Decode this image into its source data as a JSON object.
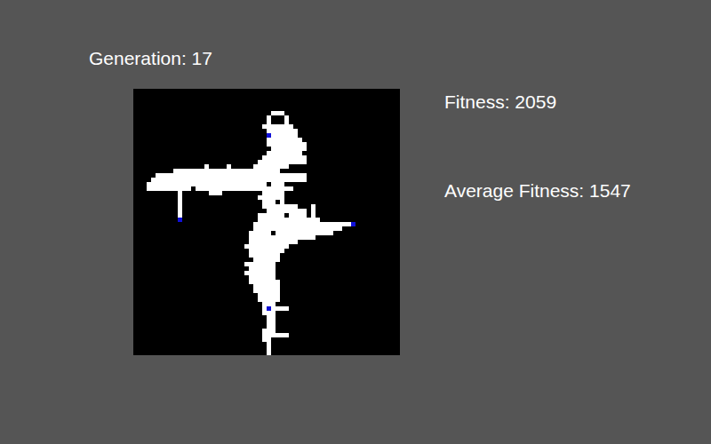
{
  "generation_label": "Generation: 17",
  "fitness_label": "Fitness: 2059",
  "average_fitness_label": "Average Fitness: 1547",
  "grid": {
    "cells": [
      [
        5,
        31,
        33
      ],
      [
        6,
        30,
        30
      ],
      [
        6,
        34,
        34
      ],
      [
        7,
        30,
        30
      ],
      [
        7,
        34,
        34
      ],
      [
        8,
        29,
        35
      ],
      [
        9,
        30,
        36
      ],
      [
        10,
        30,
        36
      ],
      [
        11,
        30,
        37
      ],
      [
        12,
        30,
        38
      ],
      [
        13,
        31,
        38
      ],
      [
        14,
        30,
        37
      ],
      [
        15,
        29,
        35
      ],
      [
        15,
        36,
        38
      ],
      [
        16,
        28,
        38
      ],
      [
        17,
        16,
        16
      ],
      [
        17,
        21,
        21
      ],
      [
        17,
        27,
        34
      ],
      [
        18,
        9,
        32
      ],
      [
        19,
        5,
        38
      ],
      [
        20,
        4,
        38
      ],
      [
        21,
        3,
        29
      ],
      [
        21,
        31,
        33
      ],
      [
        22,
        3,
        12
      ],
      [
        22,
        14,
        28
      ],
      [
        22,
        29,
        35
      ],
      [
        23,
        10,
        10
      ],
      [
        23,
        17,
        19
      ],
      [
        23,
        29,
        33
      ],
      [
        24,
        10,
        10
      ],
      [
        24,
        28,
        33
      ],
      [
        25,
        10,
        10
      ],
      [
        25,
        29,
        31
      ],
      [
        25,
        33,
        33
      ],
      [
        26,
        10,
        10
      ],
      [
        26,
        29,
        36
      ],
      [
        26,
        40,
        40
      ],
      [
        27,
        10,
        10
      ],
      [
        27,
        30,
        38
      ],
      [
        27,
        40,
        40
      ],
      [
        28,
        10,
        10
      ],
      [
        28,
        28,
        33
      ],
      [
        28,
        35,
        38
      ],
      [
        28,
        40,
        40
      ],
      [
        29,
        10,
        10
      ],
      [
        29,
        28,
        41
      ],
      [
        30,
        27,
        48
      ],
      [
        31,
        27,
        46
      ],
      [
        32,
        26,
        30
      ],
      [
        32,
        32,
        44
      ],
      [
        33,
        26,
        40
      ],
      [
        34,
        26,
        36
      ],
      [
        35,
        25,
        34
      ],
      [
        36,
        26,
        33
      ],
      [
        37,
        26,
        32
      ],
      [
        38,
        27,
        32
      ],
      [
        39,
        25,
        31
      ],
      [
        40,
        26,
        31
      ],
      [
        41,
        25,
        31
      ],
      [
        42,
        26,
        31
      ],
      [
        43,
        26,
        32
      ],
      [
        44,
        27,
        32
      ],
      [
        45,
        27,
        32
      ],
      [
        46,
        28,
        32
      ],
      [
        47,
        28,
        32
      ],
      [
        48,
        29,
        31
      ],
      [
        49,
        29,
        34
      ],
      [
        50,
        29,
        31
      ],
      [
        51,
        30,
        31
      ],
      [
        52,
        30,
        31
      ],
      [
        53,
        30,
        31
      ],
      [
        54,
        29,
        31
      ],
      [
        55,
        29,
        34
      ],
      [
        56,
        29,
        30
      ],
      [
        57,
        30,
        30
      ],
      [
        58,
        30,
        30
      ],
      [
        59,
        30,
        30
      ]
    ],
    "markers": [
      {
        "col": 30,
        "row": 10
      },
      {
        "col": 10,
        "row": 29
      },
      {
        "col": 49,
        "row": 30
      },
      {
        "col": 30,
        "row": 49
      }
    ]
  }
}
